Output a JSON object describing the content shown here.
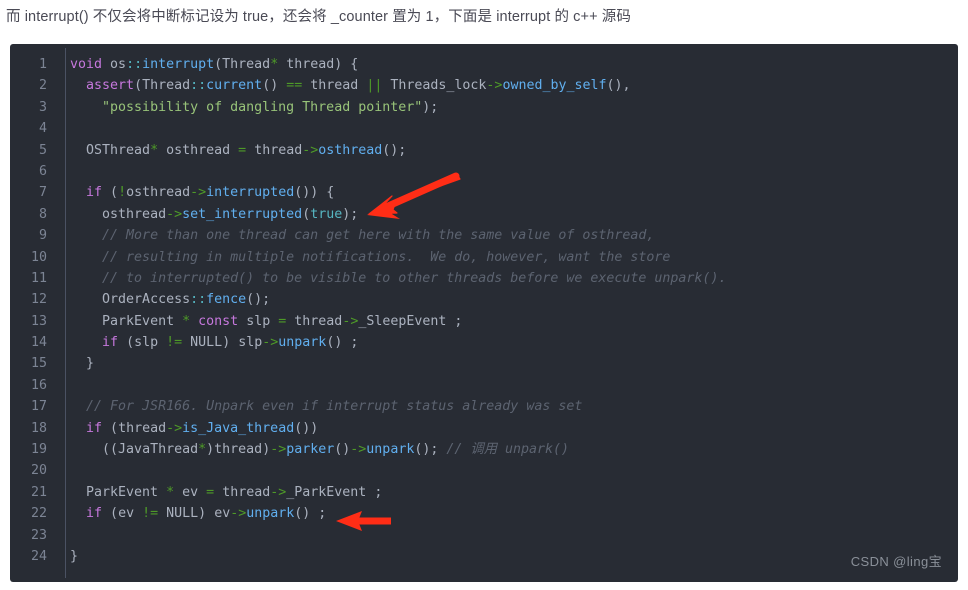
{
  "intro": {
    "text": "而 interrupt() 不仅会将中断标记设为 true，还会将 _counter 置为 1，下面是 interrupt 的 c++ 源码"
  },
  "watermark": {
    "text": "CSDN @ling宝"
  },
  "colors": {
    "page_background": "#ffffff",
    "code_background": "#282c34",
    "gutter_text": "#7c8494",
    "default_text": "#abb2bf",
    "keyword": "#c678dd",
    "function": "#61afef",
    "operator_cyan": "#56b6c2",
    "operator_green": "#4e9a28",
    "string": "#98c379",
    "comment": "#5c6370",
    "arrow": "#ff2d16",
    "intro_text": "#4a4a55"
  },
  "code": {
    "language": "cpp",
    "line_count": 24,
    "line_numbers": [
      "1",
      "2",
      "3",
      "4",
      "5",
      "6",
      "7",
      "8",
      "9",
      "10",
      "11",
      "12",
      "13",
      "14",
      "15",
      "16",
      "17",
      "18",
      "19",
      "20",
      "21",
      "22",
      "23",
      "24"
    ],
    "lines": [
      "void os::interrupt(Thread* thread) {",
      "  assert(Thread::current() == thread || Threads_lock->owned_by_self(),",
      "    \"possibility of dangling Thread pointer\");",
      "",
      "  OSThread* osthread = thread->osthread();",
      "",
      "  if (!osthread->interrupted()) {",
      "    osthread->set_interrupted(true);",
      "    // More than one thread can get here with the same value of osthread,",
      "    // resulting in multiple notifications.  We do, however, want the store",
      "    // to interrupted() to be visible to other threads before we execute unpark().",
      "    OrderAccess::fence();",
      "    ParkEvent * const slp = thread->_SleepEvent ;",
      "    if (slp != NULL) slp->unpark() ;",
      "  }",
      "",
      "  // For JSR166. Unpark even if interrupt status already was set",
      "  if (thread->is_Java_thread())",
      "    ((JavaThread*)thread)->parker()->unpark(); // 调用 unpark()",
      "",
      "  ParkEvent * ev = thread->_ParkEvent ;",
      "  if (ev != NULL) ev->unpark() ;",
      "",
      "}"
    ]
  },
  "annotations": {
    "arrows": [
      {
        "name": "arrow-to-set-interrupted",
        "target_line": 8,
        "target_text": "osthread->set_interrupted(true);"
      },
      {
        "name": "arrow-to-ev-unpark",
        "target_line": 22,
        "target_text": "if (ev != NULL) ev->unpark() ;"
      }
    ]
  }
}
